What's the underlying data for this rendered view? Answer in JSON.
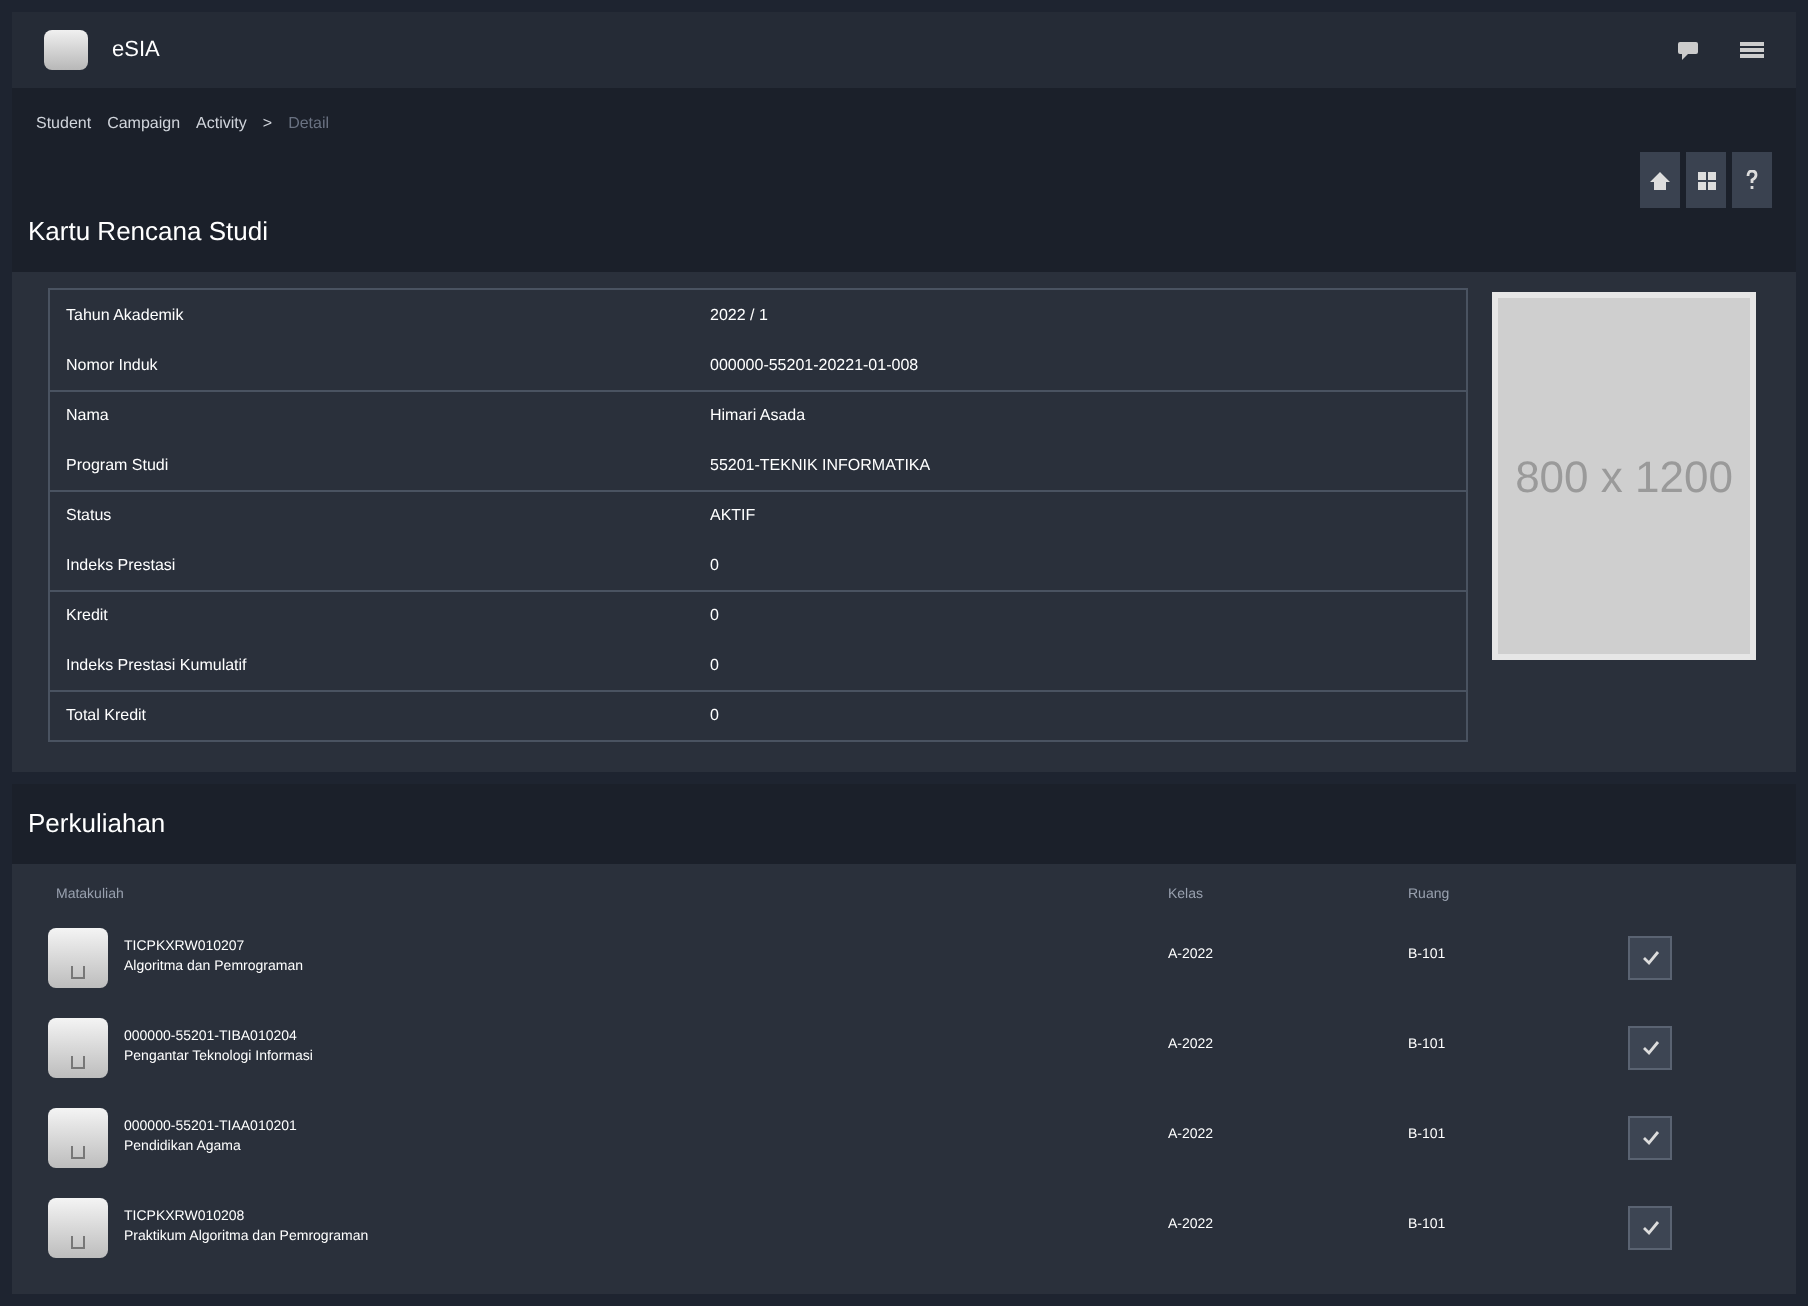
{
  "app": {
    "title": "eSIA"
  },
  "breadcrumb": [
    {
      "label": "Student"
    },
    {
      "label": "Campaign"
    },
    {
      "label": "Activity"
    },
    {
      "label": ">"
    },
    {
      "label": "Detail"
    }
  ],
  "section_title": "Kartu Rencana Studi",
  "info": [
    {
      "label": "Tahun Akademik",
      "value": "2022 / 1"
    },
    {
      "label": "Nomor Induk",
      "value": "000000-55201-20221-01-008"
    },
    {
      "label": "Nama",
      "value": "Himari Asada"
    },
    {
      "label": "Program Studi",
      "value": "55201-TEKNIK INFORMATIKA"
    },
    {
      "label": "Status",
      "value": "AKTIF"
    },
    {
      "label": "Indeks Prestasi",
      "value": "0"
    },
    {
      "label": "Kredit",
      "value": "0"
    },
    {
      "label": "Indeks Prestasi Kumulatif",
      "value": "0"
    },
    {
      "label": "Total Kredit",
      "value": "0"
    }
  ],
  "photo_placeholder": "800 x 1200",
  "courses": {
    "title": "Perkuliahan",
    "columns": [
      "Matakuliah",
      "Kelas",
      "Ruang"
    ],
    "rows": [
      {
        "code": "TICPKXRW010207",
        "name": "Algoritma dan Pemrograman",
        "class": "A-2022",
        "room": "B-101",
        "checked": true
      },
      {
        "code": "000000-55201-TIBA010204",
        "name": "Pengantar Teknologi Informasi",
        "class": "A-2022",
        "room": "B-101",
        "checked": true
      },
      {
        "code": "000000-55201-TIAA010201",
        "name": "Pendidikan Agama",
        "class": "A-2022",
        "room": "B-101",
        "checked": true
      },
      {
        "code": "TICPKXRW010208",
        "name": "Praktikum Algoritma dan Pemrograman",
        "class": "A-2022",
        "room": "B-101",
        "checked": true
      }
    ]
  }
}
